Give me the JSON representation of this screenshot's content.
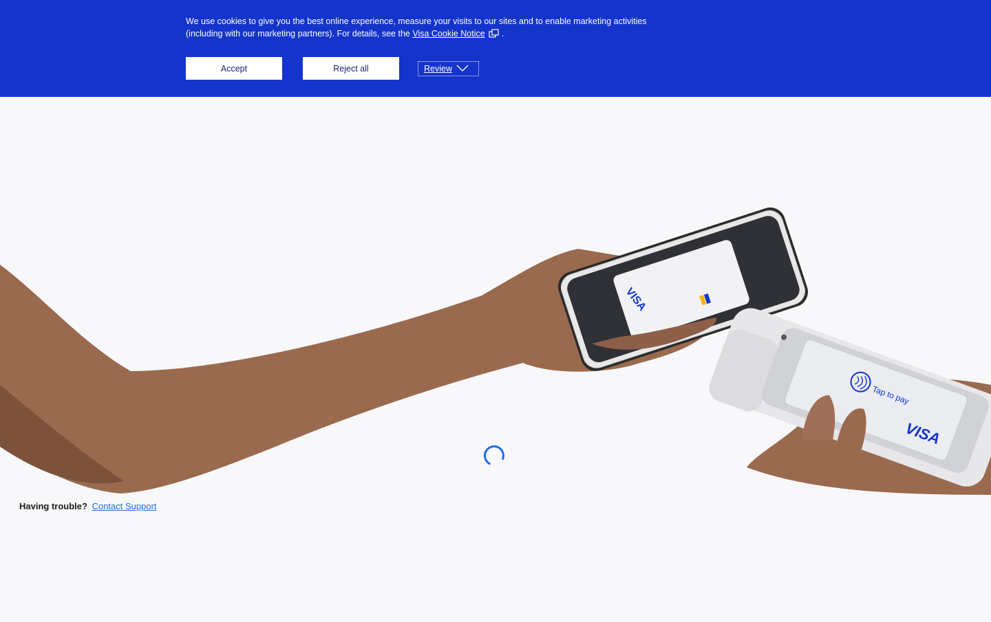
{
  "cookie_banner": {
    "text_line1": "We use cookies to give you the best online experience, measure your visits to our sites and to enable marketing activities",
    "text_line2": "(including with our marketing partners). For details, see the",
    "link_text": "Visa Cookie Notice",
    "period": ".",
    "accept_label": "Accept",
    "reject_label": "Reject all",
    "review_label": "Review",
    "external_icon": "external-link-icon",
    "chevron_icon": "chevron-down-icon",
    "background_color": "#1434cb"
  },
  "hero": {
    "phone_card_brand": "VISA",
    "terminal_text": "Tap to pay",
    "terminal_brand": "VISA",
    "spinner_color": "#1a6cf0"
  },
  "help": {
    "question": "Having trouble?",
    "link_text": "Contact Support"
  }
}
